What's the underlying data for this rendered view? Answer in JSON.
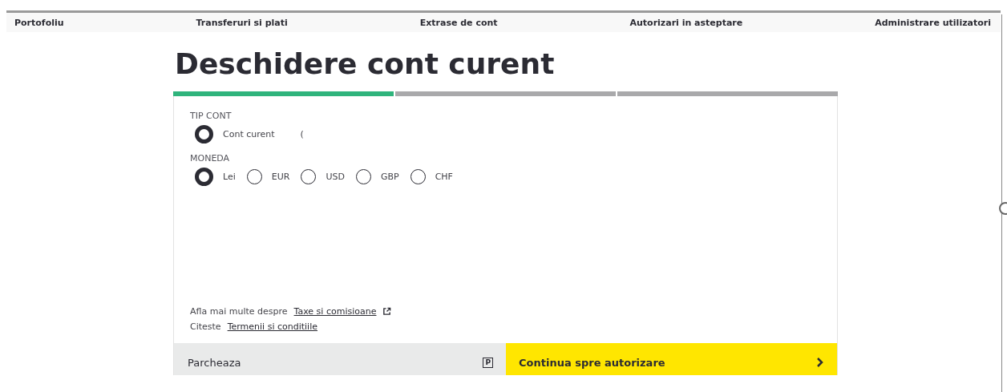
{
  "nav": {
    "items": [
      {
        "label": "Portofoliu"
      },
      {
        "label": "Transferuri si plati"
      },
      {
        "label": "Extrase de cont"
      },
      {
        "label": "Autorizari in asteptare"
      },
      {
        "label": "Administrare utilizatori"
      }
    ]
  },
  "title": "Deschidere cont curent",
  "steps": [
    {
      "completed": true
    },
    {
      "completed": false
    },
    {
      "completed": false
    }
  ],
  "account_type": {
    "label": "TIP CONT",
    "options": [
      {
        "label": "Cont curent",
        "suffix": "(",
        "selected": true
      }
    ]
  },
  "currency": {
    "label": "MONEDA",
    "options": [
      {
        "label": "Lei",
        "selected": true
      },
      {
        "label": "EUR",
        "selected": false
      },
      {
        "label": "USD",
        "selected": false
      },
      {
        "label": "GBP",
        "selected": false
      },
      {
        "label": "CHF",
        "selected": false
      }
    ]
  },
  "info": [
    {
      "text": "Afla mai multe despre",
      "link": "Taxe si comisioane",
      "external": true
    },
    {
      "text": "Citeste",
      "link": "Termenii si conditiile",
      "external": false
    }
  ],
  "park_button": {
    "label": "Parcheaza",
    "icon": "P"
  },
  "continue_button": {
    "label": "Continua spre autorizare"
  }
}
